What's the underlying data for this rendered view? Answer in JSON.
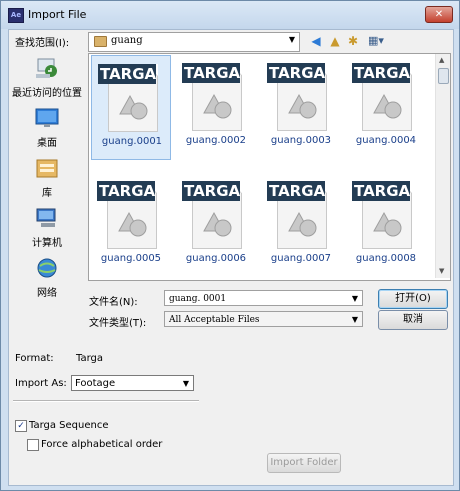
{
  "window": {
    "title": "Import File",
    "app_icon": "Ae",
    "close_symbol": "✕"
  },
  "lookin": {
    "label": "查找范围(I):",
    "value": "guang"
  },
  "places": [
    {
      "label": "最近访问的位置",
      "icon": "recent-places-icon"
    },
    {
      "label": "桌面",
      "icon": "desktop-icon"
    },
    {
      "label": "库",
      "icon": "libraries-icon"
    },
    {
      "label": "计算机",
      "icon": "computer-icon"
    },
    {
      "label": "网络",
      "icon": "network-icon"
    }
  ],
  "files": [
    {
      "name": "guang.0001",
      "badge": "TARGA"
    },
    {
      "name": "guang.0002",
      "badge": "TARGA"
    },
    {
      "name": "guang.0003",
      "badge": "TARGA"
    },
    {
      "name": "guang.0004",
      "badge": "TARGA"
    },
    {
      "name": "guang.0005",
      "badge": "TARGA"
    },
    {
      "name": "guang.0006",
      "badge": "TARGA"
    },
    {
      "name": "guang.0007",
      "badge": "TARGA"
    },
    {
      "name": "guang.0008",
      "badge": "TARGA"
    }
  ],
  "filename": {
    "label": "文件名(N):",
    "value": "guang. 0001"
  },
  "filetype": {
    "label": "文件类型(T):",
    "value": "All Acceptable Files"
  },
  "buttons": {
    "open": "打开(O)",
    "cancel": "取消",
    "import_folder": "Import Folder"
  },
  "format": {
    "label": "Format:",
    "value": "Targa"
  },
  "import_as": {
    "label": "Import As:",
    "value": "Footage"
  },
  "options": {
    "targa_sequence": {
      "label": "Targa Sequence",
      "checked": true
    },
    "force_alpha": {
      "label": "Force alphabetical order",
      "checked": false
    }
  },
  "colors": {
    "badge": "#233c54",
    "title_bar": "#cfdff0",
    "selection": "#dcebfa",
    "file_name": "#1a3f8a"
  }
}
